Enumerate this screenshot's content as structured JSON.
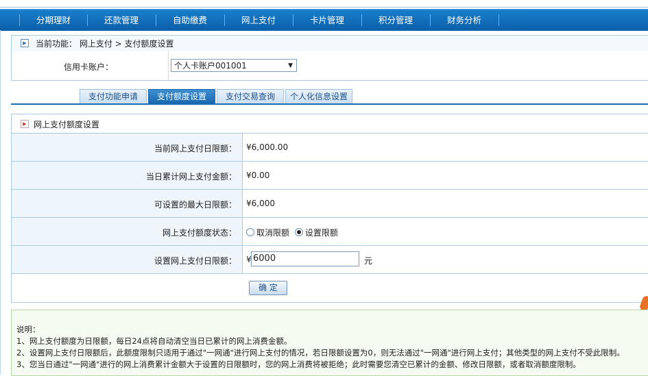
{
  "nav": {
    "items": [
      "分期理财",
      "还款管理",
      "自助缴费",
      "网上支付",
      "卡片管理",
      "积分管理",
      "财务分析"
    ]
  },
  "current_function": "当前功能： 网上支付 > 支付额度设置",
  "account": {
    "label": "信用卡账户：",
    "selected": "个人卡账户001001"
  },
  "tabs": [
    "支付功能申请",
    "支付额度设置",
    "支付交易查询",
    "个人化信息设置"
  ],
  "active_tab": "支付额度设置",
  "panel": {
    "title": "网上支付额度设置",
    "rows": {
      "daily_limit": {
        "label": "当前网上支付日限额：",
        "value": "¥6,000.00"
      },
      "accumulated": {
        "label": "当日累计网上支付金额：",
        "value": "¥0.00"
      },
      "max_limit": {
        "label": "可设置的最大日限额：",
        "value": "¥6,000"
      },
      "status": {
        "label": "网上支付额度状态：",
        "option_cancel": "取消限额",
        "option_set": "设置限额",
        "selected": "设置限额"
      },
      "set_limit": {
        "label": "设置网上支付日限额：",
        "currency": "¥",
        "input_value": "6000",
        "unit": "元"
      }
    },
    "confirm_label": "确 定"
  },
  "notes": {
    "title": "说明：",
    "lines": [
      "1、网上支付额度为日限额，每日24点将自动清空当日已累计的网上消费金额。",
      "2、设置网上支付日限额后，此额度限制只适用于通过\"一网通\"进行网上支付的情况，若日限额设置为0，则无法通过\"一网通\"进行网上支付；其他类型的网上支付不受此限制。",
      "3、您当日通过\"一网通\"进行的网上消费累计金额大于设置的日限额时，您的网上消费将被拒绝；此时需要您清空已累计的金额、修改日限额，或者取消额度限制。"
    ]
  },
  "colors": {
    "nav_bg": "#0b5ea8",
    "active_tab": "#1866ad",
    "border": "#a9cbe6",
    "label_bg": "#eef5fb"
  }
}
